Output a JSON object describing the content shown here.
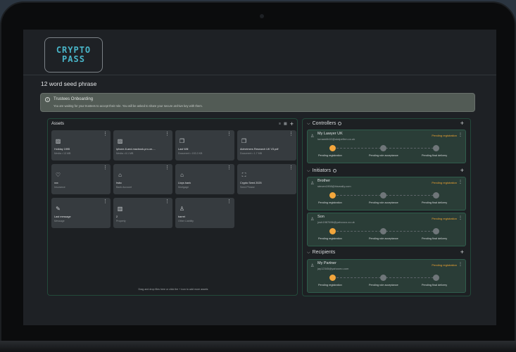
{
  "app": {
    "logo_line1": "CRYPTO",
    "logo_line2": "PASS",
    "page_title": "12 word seed phrase"
  },
  "banner": {
    "title": "Trustees Onboarding",
    "text": "You are waiting for your trustees to accept their role. You will be asked to share your secure archive key with them."
  },
  "assets": {
    "title": "Assets",
    "hint": "Drag and drop files here or click the + icon to add more assets",
    "items": [
      {
        "name": "Holiday 1995",
        "sub": "Media • 13 MB",
        "icon": "image-file-icon",
        "glyph": "▨"
      },
      {
        "name": "iphone-8-and-macbook-pro-on-...",
        "sub": "Media • 8.1 MB",
        "icon": "image-file-icon",
        "glyph": "▨"
      },
      {
        "name": "Last Will",
        "sub": "Document • 153.3 KB",
        "icon": "scroll-document-icon",
        "glyph": "❐"
      },
      {
        "name": "Alzheimers Research UK V3.pdf",
        "sub": "Document • 1.7 MB",
        "icon": "scroll-document-icon",
        "glyph": "❐"
      },
      {
        "name": "xxx",
        "sub": "Insurance",
        "icon": "heart-plus-icon",
        "glyph": "♡"
      },
      {
        "name": "hsbc",
        "sub": "Bank Account",
        "icon": "bank-icon",
        "glyph": "⌂"
      },
      {
        "name": "Lloys bank",
        "sub": "Mortgage",
        "icon": "house-icon",
        "glyph": "⌂"
      },
      {
        "name": "Crypto Seed 2025",
        "sub": "Seed Phrase",
        "icon": "scan-frame-icon",
        "glyph": "⛶"
      },
      {
        "name": "Last message",
        "sub": "Message",
        "icon": "edit-icon",
        "glyph": "✎"
      },
      {
        "name": "2",
        "sub": "Property",
        "icon": "building-icon",
        "glyph": "▥"
      },
      {
        "name": "barret",
        "sub": "Other Liability",
        "icon": "liability-icon",
        "glyph": "♙"
      }
    ]
  },
  "steps": [
    "Pending registration",
    "Pending role acceptance",
    "Pending final delivery"
  ],
  "controllers": {
    "title": "Controllers",
    "people": [
      {
        "name": "My Lawyer UK",
        "email": "lornamith02@ukdpefirm.co.uk",
        "status": "Pending registration"
      }
    ]
  },
  "initiators": {
    "title": "Initiators",
    "people": [
      {
        "name": "Brother",
        "email": "steven1998@hismally.com",
        "status": "Pending registration"
      },
      {
        "name": "Son",
        "email": "josh1987656@yahooco.co.uk",
        "status": "Pending registration"
      }
    ]
  },
  "recipients": {
    "title": "Recipients",
    "people": [
      {
        "name": "My Partner",
        "email": "jay12345@yahooeo.com",
        "status": "Pending registration"
      }
    ]
  },
  "colors": {
    "accent": "#f3a63c",
    "brand": "#49b6c9",
    "panel_border": "#234a3b"
  }
}
